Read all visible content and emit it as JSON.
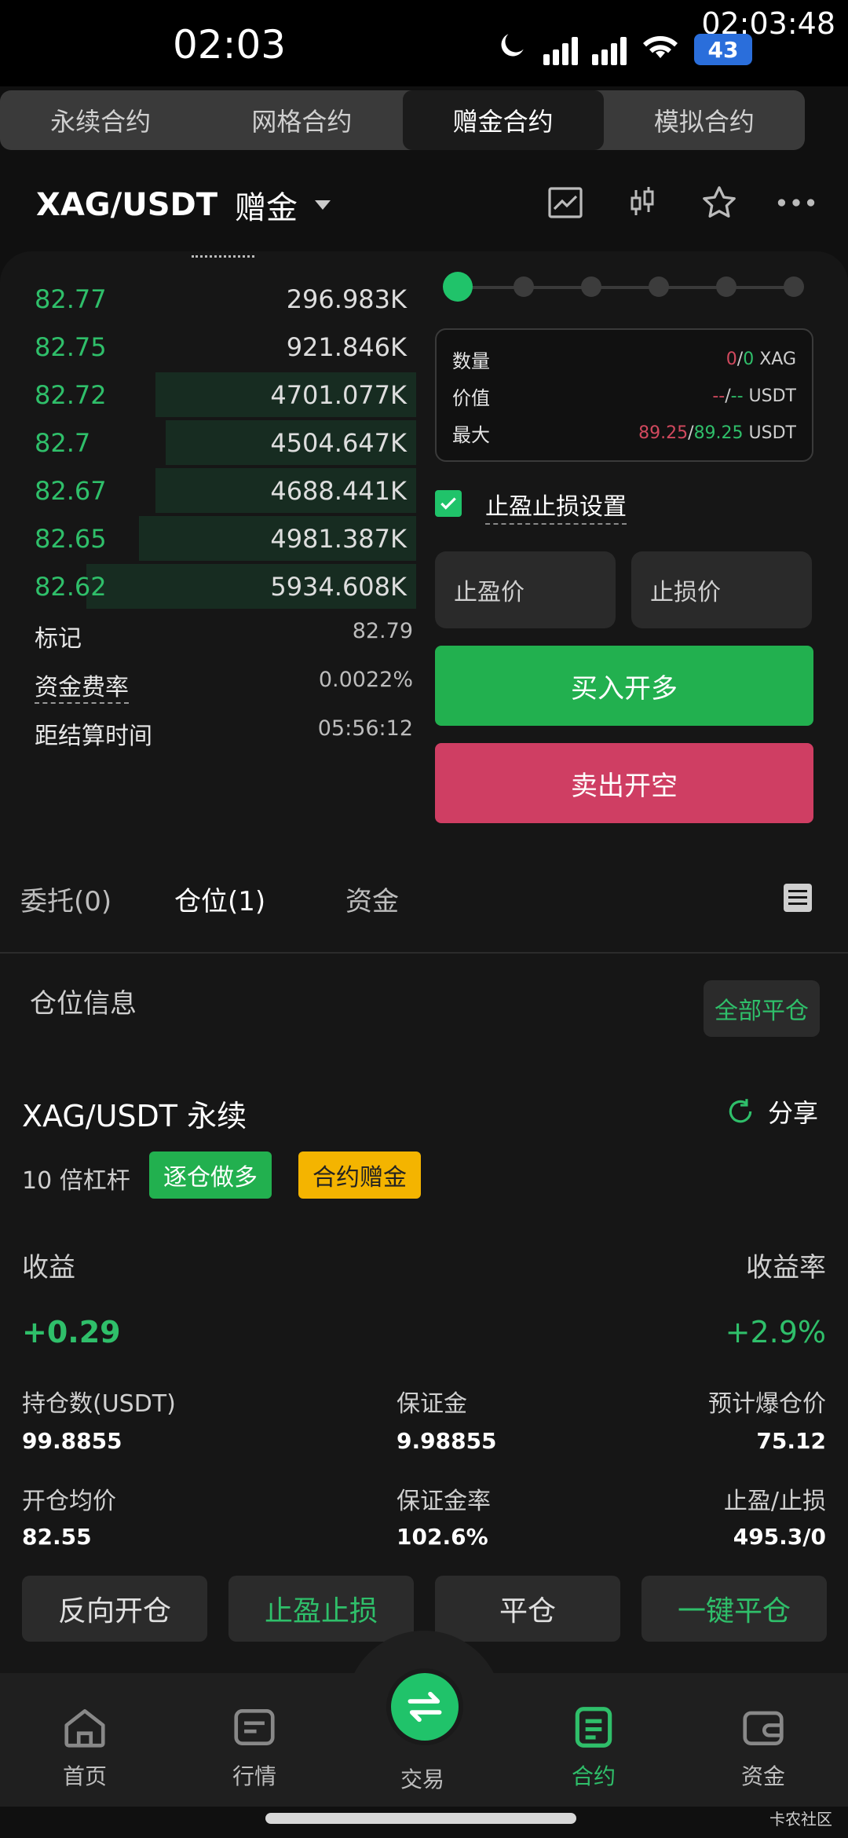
{
  "status_bar": {
    "time": "02:03",
    "clock_overlay": "02:03:48",
    "battery": "43",
    "icons": [
      "moon-icon",
      "signal-icon",
      "signal-icon",
      "wifi-icon",
      "battery-icon"
    ]
  },
  "top_tabs": [
    {
      "label": "永续合约",
      "active": false
    },
    {
      "label": "网格合约",
      "active": false
    },
    {
      "label": "赠金合约",
      "active": true
    },
    {
      "label": "模拟合约",
      "active": false
    }
  ],
  "pair": {
    "symbol": "XAG/USDT",
    "mode": "赠金"
  },
  "order_book": [
    {
      "price": "82.77",
      "qty": "296.983K",
      "depth": 0.0
    },
    {
      "price": "82.75",
      "qty": "921.846K",
      "depth": 0.0
    },
    {
      "price": "82.72",
      "qty": "4701.077K",
      "depth": 0.79
    },
    {
      "price": "82.7",
      "qty": "4504.647K",
      "depth": 0.76
    },
    {
      "price": "82.67",
      "qty": "4688.441K",
      "depth": 0.79
    },
    {
      "price": "82.65",
      "qty": "4981.387K",
      "depth": 0.84
    },
    {
      "price": "82.62",
      "qty": "5934.608K",
      "depth": 1.0
    }
  ],
  "market_info": {
    "mark_label": "标记",
    "mark_value": "82.79",
    "funding_label": "资金费率",
    "funding_value": "0.0022%",
    "settle_label": "距结算时间",
    "settle_value": "05:56:12"
  },
  "form": {
    "qty_label": "数量",
    "qty_a": "0",
    "qty_b": "0",
    "qty_unit": "XAG",
    "value_label": "价值",
    "value_a": "--",
    "value_b": "--",
    "value_unit": "USDT",
    "max_label": "最大",
    "max_a": "89.25",
    "max_b": "89.25",
    "max_unit": "USDT",
    "slider_level": 0,
    "tpsl_label": "止盈止损设置",
    "tp_placeholder": "止盈价",
    "sl_placeholder": "止损价",
    "buy_label": "买入开多",
    "sell_label": "卖出开空"
  },
  "position_tabs": [
    {
      "label": "委托(0)",
      "active": false
    },
    {
      "label": "仓位(1)",
      "active": true
    },
    {
      "label": "资金",
      "active": false
    }
  ],
  "positions": {
    "section_title": "仓位信息",
    "close_all": "全部平仓",
    "title": "XAG/USDT 永续",
    "share": "分享",
    "leverage": "10 倍杠杆",
    "tag_side": "逐仓做多",
    "tag_bonus": "合约赠金",
    "pnl_label": "收益",
    "pnl_value": "+0.29",
    "roe_label": "收益率",
    "roe_value": "+2.9%",
    "size_label": "持仓数(USDT)",
    "size_value": "99.8855",
    "margin_label": "保证金",
    "margin_value": "9.98855",
    "liq_label": "预计爆仓价",
    "liq_value": "75.12",
    "entry_label": "开仓均价",
    "entry_value": "82.55",
    "margin_rate_label": "保证金率",
    "margin_rate_value": "102.6%",
    "tpsl_label": "止盈/止损",
    "tpsl_value": "495.3/0",
    "actions": [
      "反向开仓",
      "止盈止损",
      "平仓",
      "一键平仓"
    ]
  },
  "bottom_nav": [
    {
      "label": "首页",
      "icon": "home-icon",
      "active": false
    },
    {
      "label": "行情",
      "icon": "market-icon",
      "active": false
    },
    {
      "label": "交易",
      "icon": "swap-icon",
      "active": false
    },
    {
      "label": "合约",
      "icon": "contract-icon",
      "active": true
    },
    {
      "label": "资金",
      "icon": "wallet-icon",
      "active": false
    }
  ],
  "watermark": "卡农社区"
}
